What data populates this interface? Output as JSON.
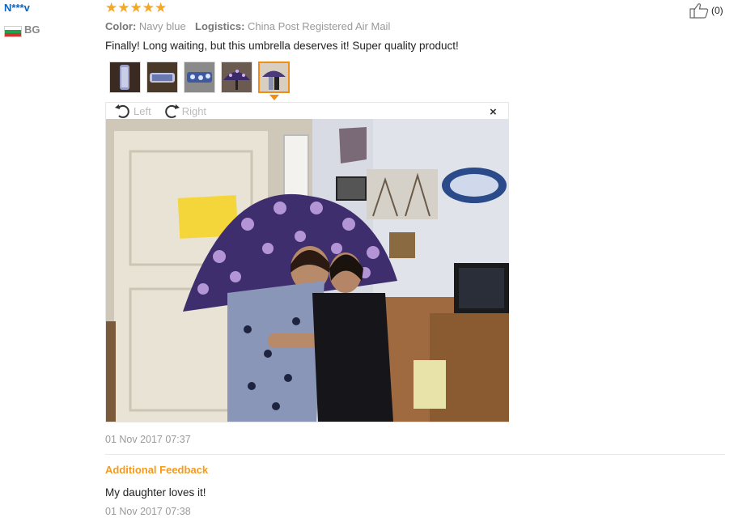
{
  "review": {
    "username": "N***v",
    "country": "BG",
    "stars": "★★★★★",
    "color_label": "Color:",
    "color_value": "Navy blue",
    "logistics_label": "Logistics:",
    "logistics_value": "China Post Registered Air Mail",
    "text": "Finally! Long waiting, but this umbrella deserves it! Super quality product!",
    "helpful_count": "(0)",
    "date": "01 Nov 2017 07:37"
  },
  "viewer": {
    "rotate_left": "Left",
    "rotate_right": "Right",
    "close": "×"
  },
  "additional": {
    "title": "Additional Feedback",
    "text": "My daughter loves it!",
    "date": "01 Nov 2017 07:38"
  },
  "colors": {
    "accent": "#f08c1a",
    "username": "#0a66c2",
    "star": "#f5a623"
  }
}
